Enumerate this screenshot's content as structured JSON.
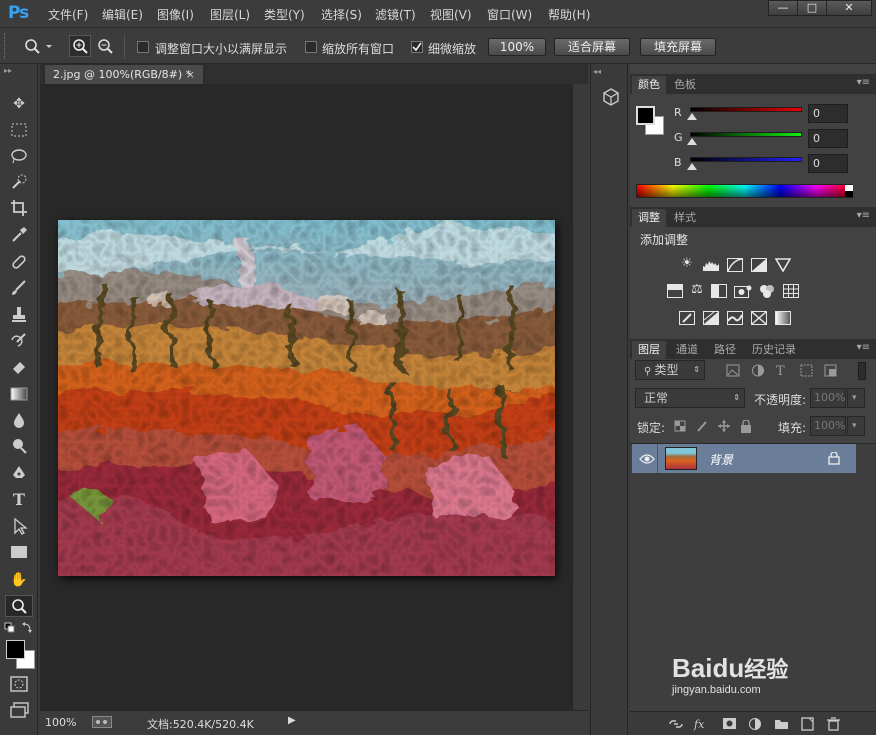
{
  "app": {
    "logo": "Ps"
  },
  "menubar": {
    "items": [
      "文件(F)",
      "编辑(E)",
      "图像(I)",
      "图层(L)",
      "类型(Y)",
      "选择(S)",
      "滤镜(T)",
      "视图(V)",
      "窗口(W)",
      "帮助(H)"
    ],
    "window_buttons": {
      "minimize": "—",
      "maximize": "□",
      "close": "✕"
    }
  },
  "options_bar": {
    "resize_windows_label": "调整窗口大小以满屏显示",
    "resize_windows_checked": false,
    "zoom_all_label": "缩放所有窗口",
    "zoom_all_checked": false,
    "scrubby_zoom_label": "细微缩放",
    "scrubby_zoom_checked": true,
    "actual_pixels_label": "100%",
    "fit_screen_label": "适合屏幕",
    "fill_screen_label": "填充屏幕"
  },
  "document": {
    "tab_title": "2.jpg @ 100%(RGB/8#) *",
    "tab_close": "×",
    "zoom": "100%",
    "doc_size": "文档:520.4K/520.4K"
  },
  "color_panel": {
    "tabs": [
      "颜色",
      "色板"
    ],
    "r_label": "R",
    "g_label": "G",
    "b_label": "B",
    "r_value": "0",
    "g_value": "0",
    "b_value": "0",
    "foreground": "#000000",
    "background": "#ffffff"
  },
  "adjustments_panel": {
    "tabs": [
      "调整",
      "样式"
    ],
    "heading": "添加调整"
  },
  "layers_panel": {
    "tabs": [
      "图层",
      "通道",
      "路径",
      "历史记录"
    ],
    "filter_kind": "类型",
    "blend_mode": "正常",
    "opacity_label": "不透明度:",
    "opacity_value": "100%",
    "lock_label": "锁定:",
    "fill_label": "填充:",
    "fill_value": "100%",
    "layers": [
      {
        "name": "背景",
        "visible": true,
        "locked": true
      }
    ]
  },
  "watermark": {
    "brand": "Baidu",
    "suffix": "经验",
    "url": "jingyan.baidu.com"
  }
}
